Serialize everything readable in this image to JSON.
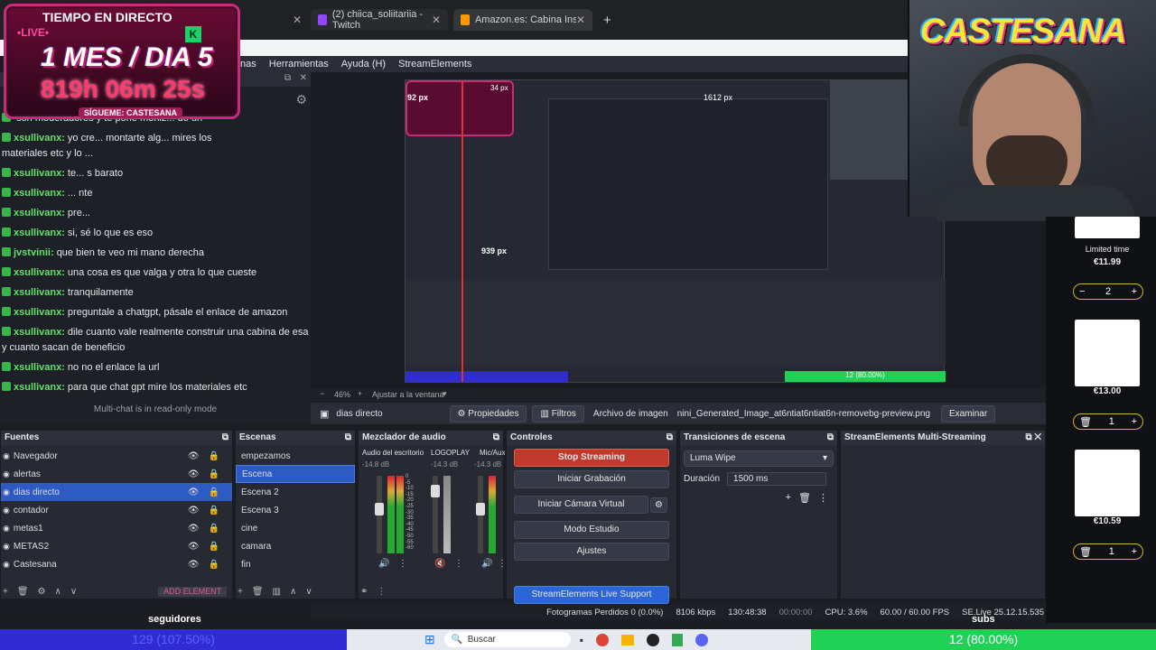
{
  "browser": {
    "tabs": [
      {
        "label": "(2) chiica_soliitariia - Twitch"
      },
      {
        "label": "Amazon.es: Cabina Insonorizad"
      }
    ]
  },
  "overlay": {
    "header": "TIEMPO EN DIRECTO",
    "live": "•LIVE•",
    "big": "1 MES / DIA 5",
    "time": "819h 06m 25s",
    "follow": "SÍGUEME: CASTESANA",
    "k_badge": "K"
  },
  "menu": {
    "items": [
      "nas",
      "Herramientas",
      "Ayuda (H)",
      "StreamElements"
    ]
  },
  "chat": {
    "lines": [
      {
        "user": "",
        "text": "son moderadores y te pone moniz... do un"
      },
      {
        "user": "xsullivanx:",
        "text": "yo cre... montarte alg... mires los"
      },
      {
        "user": "",
        "text": "materiales etc y lo ..."
      },
      {
        "user": "xsullivanx:",
        "text": "te... s barato"
      },
      {
        "user": "xsullivanx:",
        "text": "... nte"
      },
      {
        "user": "xsullivanx:",
        "text": "pre..."
      },
      {
        "user": "xsullivanx:",
        "text": "si, sé lo que es eso"
      },
      {
        "user": "jvstvinii:",
        "text": "que bien te veo mi mano derecha"
      },
      {
        "user": "xsullivanx:",
        "text": "una cosa es que valga y otra lo que cueste"
      },
      {
        "user": "xsullivanx:",
        "text": "tranquilamente"
      },
      {
        "user": "xsullivanx:",
        "text": "preguntale a chatgpt, pásale el enlace de amazon"
      },
      {
        "user": "xsullivanx:",
        "text": "dile cuanto vale realmente construir una cabina de esa"
      },
      {
        "user": "",
        "text": "y cuanto sacan de beneficio"
      },
      {
        "user": "xsullivanx:",
        "text": "no no el enlace la url"
      },
      {
        "user": "xsullivanx:",
        "text": "para que chat gpt mire los materiales etc"
      }
    ],
    "readonly": "Multi-chat is in read-only mode"
  },
  "preview": {
    "zoom": "46%",
    "fit": "Ajustar a la ventana",
    "px_top": "1612 px",
    "px_left": "92 px",
    "px_mid": "939 px",
    "px_small": "34 px"
  },
  "propbar": {
    "source": "dias directo",
    "properties": "Propiedades",
    "filters": "Filtros",
    "file_label": "Archivo de imagen",
    "file_value": "nini_Generated_Image_at6ntiat6ntiat6n-removebg-preview.png",
    "browse": "Examinar"
  },
  "sources": {
    "title": "Fuentes",
    "items": [
      "Navegador",
      "alertas",
      "dias directo",
      "contador",
      "metas1",
      "METAS2",
      "Castesana"
    ],
    "add": "ADD ELEMENT"
  },
  "scenes": {
    "title": "Escenas",
    "items": [
      "empezamos",
      "Escena",
      "Escena 2",
      "Escena 3",
      "cine",
      "camara",
      "fin"
    ]
  },
  "mixer": {
    "title": "Mezclador de audio",
    "channels": [
      {
        "name": "Audio del escritorio",
        "db": "-14.8 dB"
      },
      {
        "name": "LOGOPLAY",
        "db": "-14.3 dB"
      },
      {
        "name": "Mic/Aux",
        "db": "-14.3 dB"
      }
    ],
    "ticks": [
      "0",
      "-5",
      "-10",
      "-15",
      "-20",
      "-25",
      "-30",
      "-35",
      "-40",
      "-45",
      "-50",
      "-55",
      "-60"
    ]
  },
  "controls": {
    "title": "Controles",
    "stop": "Stop Streaming",
    "record": "Iniciar Grabación",
    "vcam": "Iniciar Cámara Virtual",
    "studio": "Modo Estudio",
    "settings": "Ajustes",
    "support": "StreamElements Live Support"
  },
  "transitions": {
    "title": "Transiciones de escena",
    "selected": "Luma Wipe",
    "duration_label": "Duración",
    "duration": "1500 ms"
  },
  "multistream": {
    "title": "StreamElements Multi-Streaming"
  },
  "status": {
    "dropped": "Fotogramas Perdidos 0 (0.0%)",
    "bitrate": "8106 kbps",
    "time": "130:48:38",
    "rec": "00:00:00",
    "cpu": "CPU: 3.6%",
    "fps": "60.00 / 60.00 FPS",
    "se": "SE.Live 25.12.15.535"
  },
  "webcam": {
    "brand": "CASTESANA"
  },
  "shop": {
    "items": [
      {
        "label": "Limited time",
        "price": "€11.99",
        "qty": "2"
      },
      {
        "label": "",
        "price": "€13.00",
        "qty": "1"
      },
      {
        "label": "",
        "price": "€10.59",
        "qty": "1"
      }
    ],
    "minus": "−",
    "plus": "+"
  },
  "bottom": {
    "left_text": "129 (107.50%)",
    "right_text": "12 (80.00%)",
    "seguidores": "seguidores",
    "subs": "subs",
    "search": "Buscar"
  },
  "colors": {
    "accent_blue": "#2e5ac4",
    "stop_red": "#c0392b",
    "chat_green": "#63e168",
    "goal_green": "#1fd255",
    "goal_blue": "#2f2bd5"
  }
}
